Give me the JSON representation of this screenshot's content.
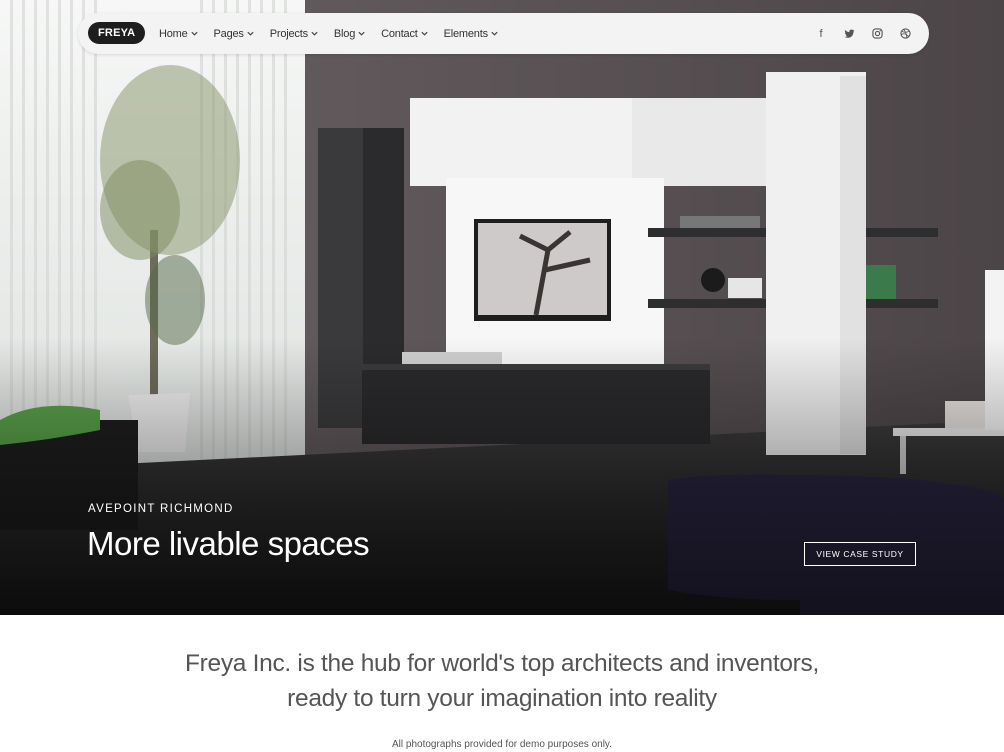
{
  "nav": {
    "logo": "FREYA",
    "items": [
      {
        "label": "Home"
      },
      {
        "label": "Pages"
      },
      {
        "label": "Projects"
      },
      {
        "label": "Blog"
      },
      {
        "label": "Contact"
      },
      {
        "label": "Elements"
      }
    ],
    "socials": [
      {
        "icon": "facebook-icon",
        "glyph": "f"
      },
      {
        "icon": "twitter-icon",
        "glyph": "🐦"
      },
      {
        "icon": "instagram-icon",
        "glyph": "◎"
      },
      {
        "icon": "dribbble-icon",
        "glyph": "⊛"
      }
    ]
  },
  "hero": {
    "subtitle": "AVEPOINT RICHMOND",
    "title": "More livable spaces",
    "cta": "VIEW CASE STUDY"
  },
  "intro": {
    "line1": "Freya Inc. is the hub for world's top architects and inventors,",
    "line2": "ready to turn your imagination into reality"
  },
  "disclaimer": "All photographs provided for demo purposes only.",
  "colors": {
    "wall": "#5b5456",
    "cabinet_white": "#ececec",
    "cabinet_dark": "#2a2a2c",
    "sofa": "#2a2540"
  }
}
